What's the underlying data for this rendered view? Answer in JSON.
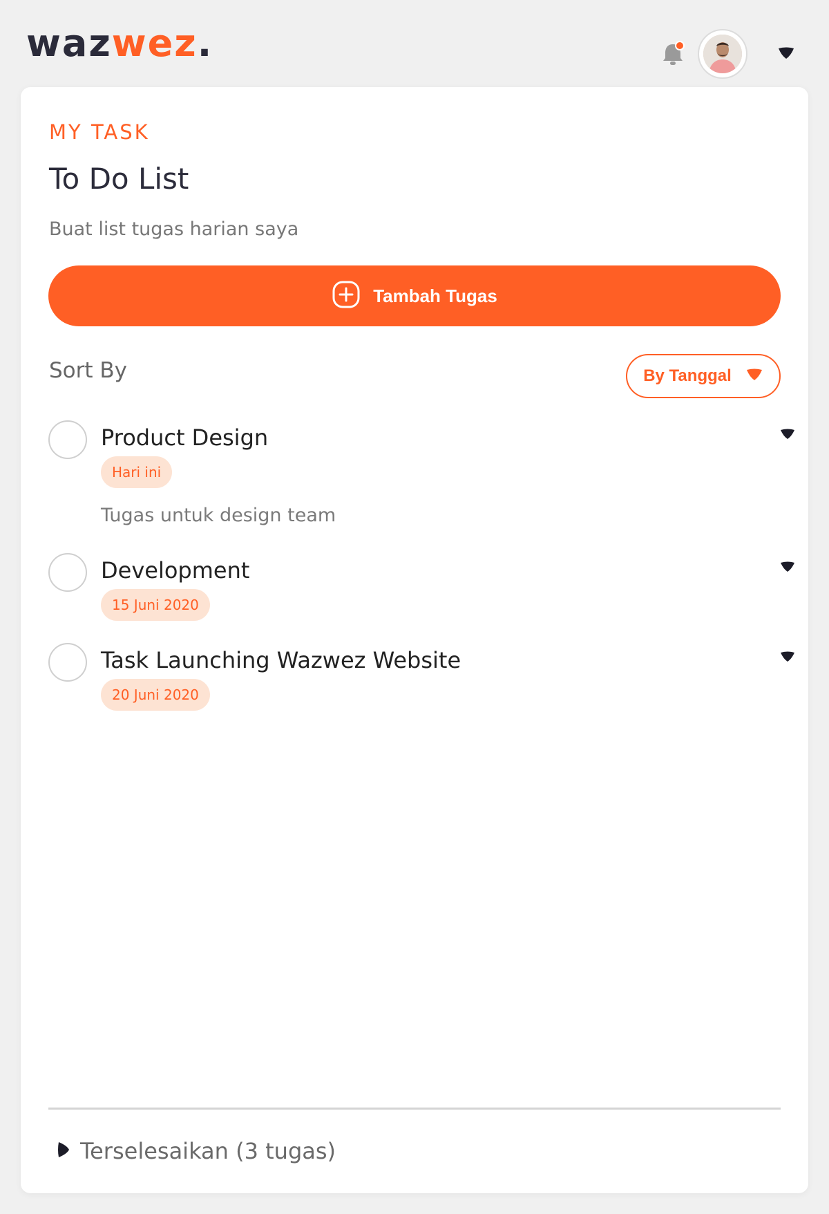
{
  "header": {
    "logo_part1": "waz",
    "logo_part2": "wez",
    "logo_dot": ".",
    "icons": [
      "bell-icon",
      "avatar",
      "chevron-down-icon"
    ],
    "colors": {
      "accent": "#ff5f25",
      "dark": "#2b2b3a",
      "notification_dot": "#ff5f25"
    }
  },
  "card": {
    "eyebrow": "MY TASK",
    "title": "To Do List",
    "subtitle": "Buat list tugas harian saya",
    "add_button_label": "Tambah Tugas",
    "sort_label": "Sort By",
    "sort_value": "By Tanggal"
  },
  "tasks": [
    {
      "title": "Product Design",
      "badge": "Hari ini",
      "description": "Tugas untuk design team"
    },
    {
      "title": "Development",
      "badge": "15 Juni 2020"
    },
    {
      "title": "Task Launching Wazwez Website",
      "badge": "20 Juni 2020"
    }
  ],
  "footer": {
    "completed_label": "Terselesaikan (3 tugas)"
  }
}
